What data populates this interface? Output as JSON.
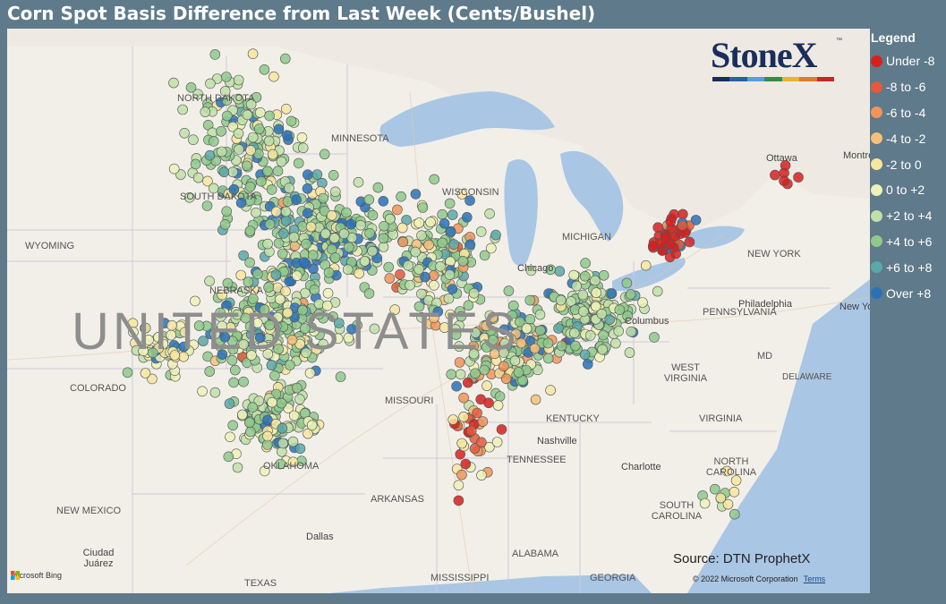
{
  "title": "Corn Spot Basis Difference from Last Week (Cents/Bushel)",
  "logo": {
    "text": "StoneX",
    "tm": "™",
    "bar_colors": [
      "#1a2e5c",
      "#2e5fa3",
      "#5aa0d4",
      "#3a8a4a",
      "#e2b830",
      "#e07a2a",
      "#c02a2a"
    ]
  },
  "legend": {
    "title": "Legend",
    "items": [
      {
        "label": "Under -8",
        "color": "#d62020"
      },
      {
        "label": "-8 to -6",
        "color": "#e35a3a"
      },
      {
        "label": "-6 to -4",
        "color": "#f0955a"
      },
      {
        "label": "-4 to -2",
        "color": "#f5c07a"
      },
      {
        "label": "-2 to 0",
        "color": "#f7e6a0"
      },
      {
        "label": "0 to +2",
        "color": "#eef2b8"
      },
      {
        "label": "+2 to +4",
        "color": "#bfe0a8"
      },
      {
        "label": "+4 to +6",
        "color": "#8fc98c"
      },
      {
        "label": "+6 to +8",
        "color": "#5aa8a8"
      },
      {
        "label": "Over +8",
        "color": "#2a72b8"
      }
    ]
  },
  "map": {
    "country_label": "UNITED STATES",
    "labels": [
      "NORTH DAKOTA",
      "MINNESOTA",
      "SOUTH DAKOTA",
      "WYOMING",
      "NEBRASKA",
      "WISCONSIN",
      "MICHIGAN",
      "NEW YORK",
      "PENNSYLVANIA",
      "COLORADO",
      "MISSOURI",
      "WEST VIRGINIA",
      "VIRGINIA",
      "KENTUCKY",
      "DELAWARE",
      "MD",
      "OKLAHOMA",
      "TENNESSEE",
      "NORTH CAROLINA",
      "NEW MEXICO",
      "ARKANSAS",
      "SOUTH CAROLINA",
      "ALABAMA",
      "MISSISSIPPI",
      "GEORGIA",
      "TEXAS"
    ],
    "cities": [
      "Chicago",
      "Columbus",
      "Philadelphia",
      "Nashville",
      "Charlotte",
      "Dallas",
      "Ciudad Juárez",
      "Ottawa",
      "Montréal",
      "New York"
    ],
    "source": "Source: DTN ProphetX",
    "copyright": "© 2022 Microsoft Corporation",
    "terms": "Terms",
    "bing": "Microsoft Bing"
  }
}
